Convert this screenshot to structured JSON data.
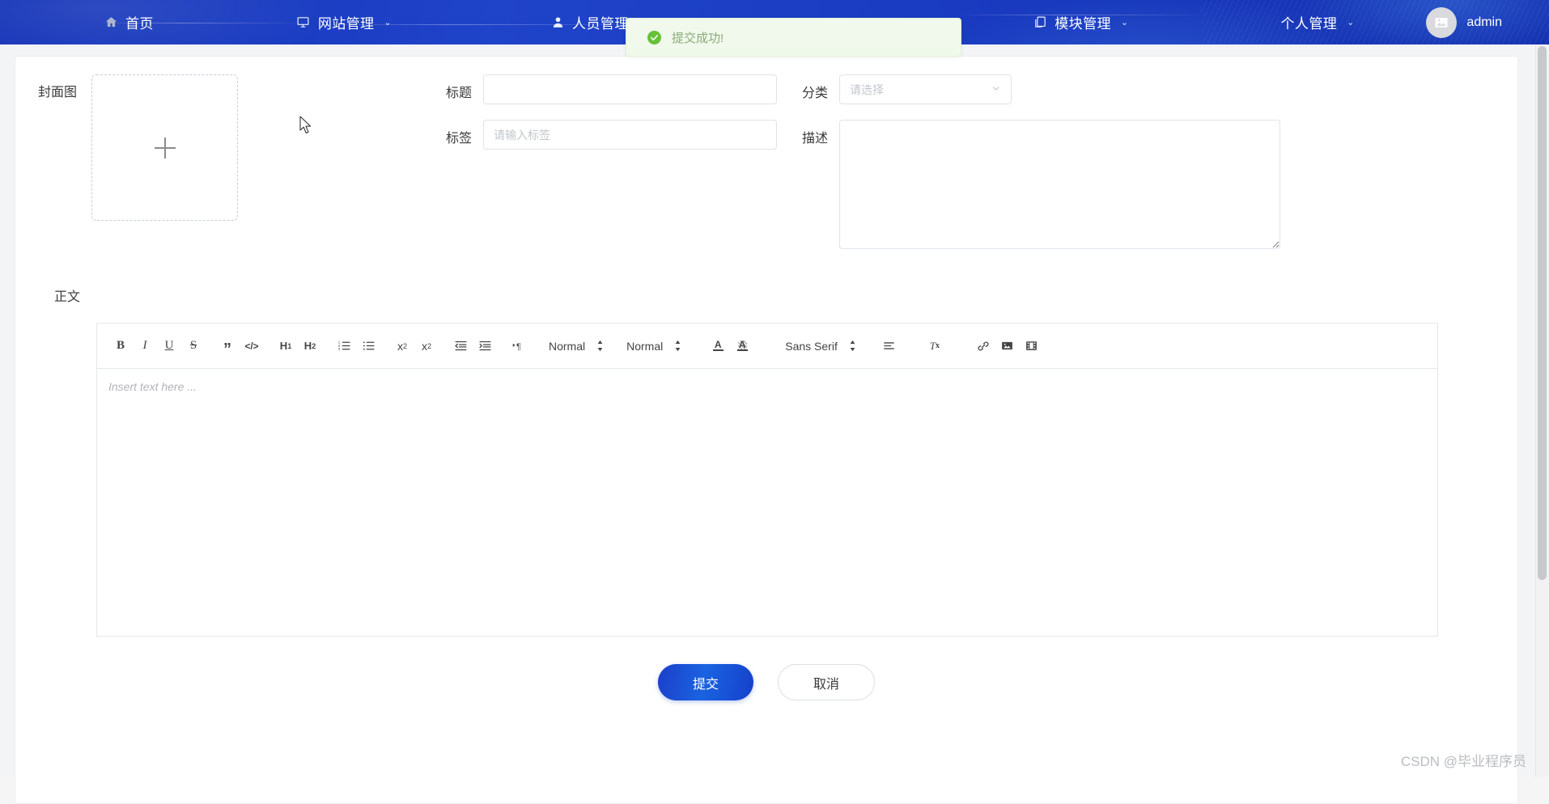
{
  "navbar": {
    "items": [
      {
        "label": "首页",
        "icon": "home-icon",
        "has_caret": false
      },
      {
        "label": "网站管理",
        "icon": "monitor-icon",
        "has_caret": true,
        "caret": "⌄"
      },
      {
        "label": "人员管理",
        "icon": "user-icon",
        "has_caret": true,
        "caret": "⌄"
      },
      {
        "label": "模块管理",
        "icon": "copy-icon",
        "has_caret": true,
        "caret": "⌄"
      },
      {
        "label": "个人管理",
        "icon": "",
        "has_caret": true,
        "caret": "⌄"
      }
    ],
    "user": {
      "name": "admin",
      "avatar_icon": "image-placeholder-icon"
    },
    "accent_color": "#1a3cc2",
    "loading_bar_color": "#4dd8ea"
  },
  "toast": {
    "message": "提交成功!",
    "icon": "success-check-icon",
    "background": "#f0f9eb",
    "text_color": "#8aab79",
    "check_color": "#67c23a"
  },
  "form": {
    "cover": {
      "label": "封面图",
      "upload_icon": "plus-icon"
    },
    "title": {
      "label": "标题",
      "value": "",
      "placeholder": ""
    },
    "tag": {
      "label": "标签",
      "value": "",
      "placeholder": "请输入标签"
    },
    "category": {
      "label": "分类",
      "selected": "请选择",
      "caret_icon": "chevron-down-icon"
    },
    "description": {
      "label": "描述",
      "value": "",
      "placeholder": ""
    },
    "body": {
      "label": "正文",
      "editor_placeholder": "Insert text here ..."
    }
  },
  "editor_toolbar": {
    "buttons": [
      {
        "name": "bold-icon",
        "label": "B"
      },
      {
        "name": "italic-icon",
        "label": "I"
      },
      {
        "name": "underline-icon",
        "label": "U"
      },
      {
        "name": "strikethrough-icon",
        "label": "S"
      },
      {
        "name": "blockquote-icon",
        "label": "”"
      },
      {
        "name": "code-block-icon",
        "label": "</>"
      },
      {
        "name": "heading-1-icon",
        "label": "H1"
      },
      {
        "name": "heading-2-icon",
        "label": "H2"
      },
      {
        "name": "ordered-list-icon",
        "label": ""
      },
      {
        "name": "bullet-list-icon",
        "label": ""
      },
      {
        "name": "subscript-icon",
        "label": "x2"
      },
      {
        "name": "superscript-icon",
        "label": "x2"
      },
      {
        "name": "outdent-icon",
        "label": ""
      },
      {
        "name": "indent-icon",
        "label": ""
      },
      {
        "name": "text-direction-icon",
        "label": "¶"
      }
    ],
    "selects": [
      {
        "name": "heading-size-select",
        "value": "Normal"
      },
      {
        "name": "line-height-select",
        "value": "Normal"
      },
      {
        "name": "font-family-select",
        "value": "Sans Serif"
      }
    ],
    "trailing_buttons": [
      {
        "name": "text-color-icon",
        "label": "A"
      },
      {
        "name": "background-color-icon",
        "label": "A"
      },
      {
        "name": "align-icon",
        "label": ""
      },
      {
        "name": "clear-format-icon",
        "label": "Tx"
      },
      {
        "name": "link-icon",
        "label": ""
      },
      {
        "name": "image-icon",
        "label": ""
      },
      {
        "name": "video-icon",
        "label": ""
      }
    ]
  },
  "actions": {
    "submit_label": "提交",
    "cancel_label": "取消"
  },
  "watermark": {
    "text": "CSDN @毕业程序员"
  }
}
